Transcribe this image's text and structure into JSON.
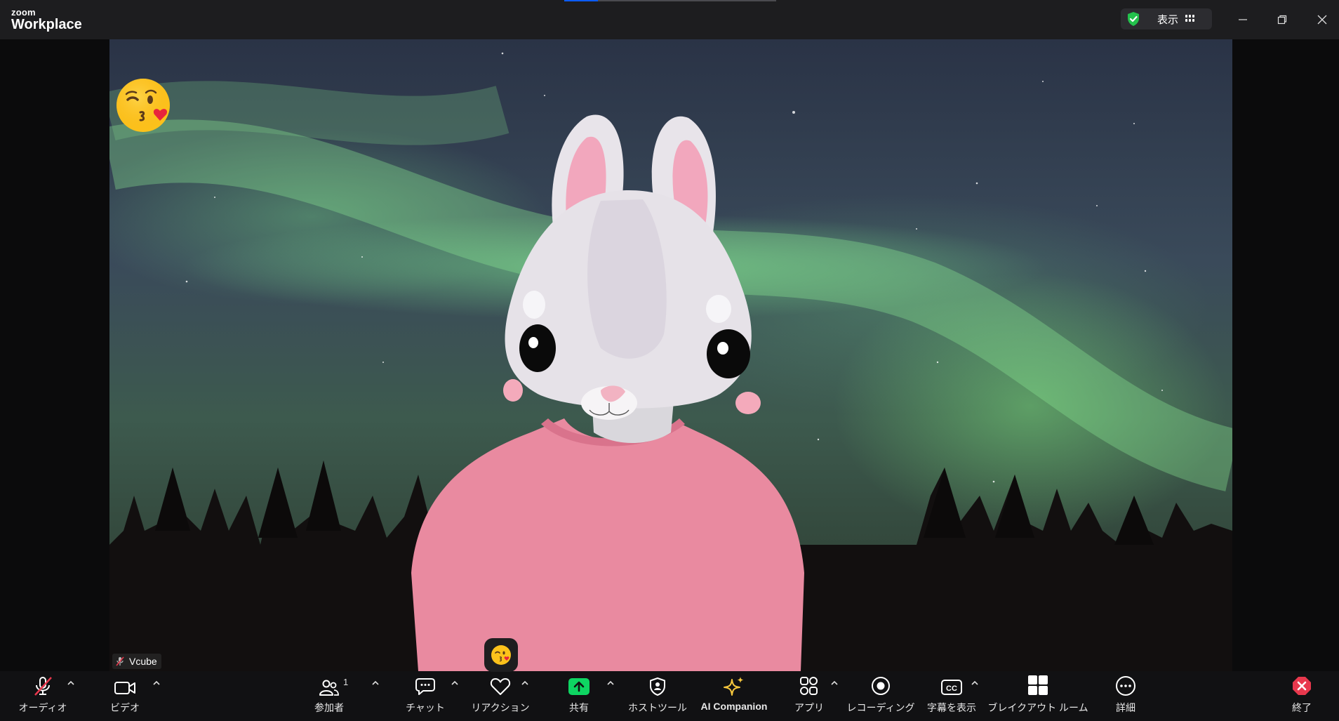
{
  "app": {
    "brand_small": "zoom",
    "brand_large": "Workplace"
  },
  "titlebar": {
    "view_label": "表示",
    "top_progress_fraction": 0.16,
    "security_color": "#23c14c",
    "icons": [
      "shield-check-icon",
      "grid-icon",
      "minimize-icon",
      "restore-icon",
      "close-icon"
    ]
  },
  "video": {
    "participant_name": "Vcube",
    "participant_muted": true,
    "overlay_emoji": "😘",
    "reaction_emoji": "😘",
    "background": "aurora over pine forest",
    "avatar": "rabbit in pink sweater"
  },
  "toolbar": {
    "audio_label": "オーディオ",
    "video_label": "ビデオ",
    "participants_label": "参加者",
    "participants_count": "1",
    "chat_label": "チャット",
    "reactions_label": "リアクション",
    "share_label": "共有",
    "host_tools_label": "ホストツール",
    "ai_companion_label": "AI Companion",
    "apps_label": "アプリ",
    "recording_label": "レコーディング",
    "captions_label": "字幕を表示",
    "breakout_label": "ブレイクアウト ルーム",
    "more_label": "詳細",
    "end_label": "終了",
    "colors": {
      "share": "#0ed562",
      "end": "#e8384d",
      "mute_slash": "#e8384d"
    }
  }
}
